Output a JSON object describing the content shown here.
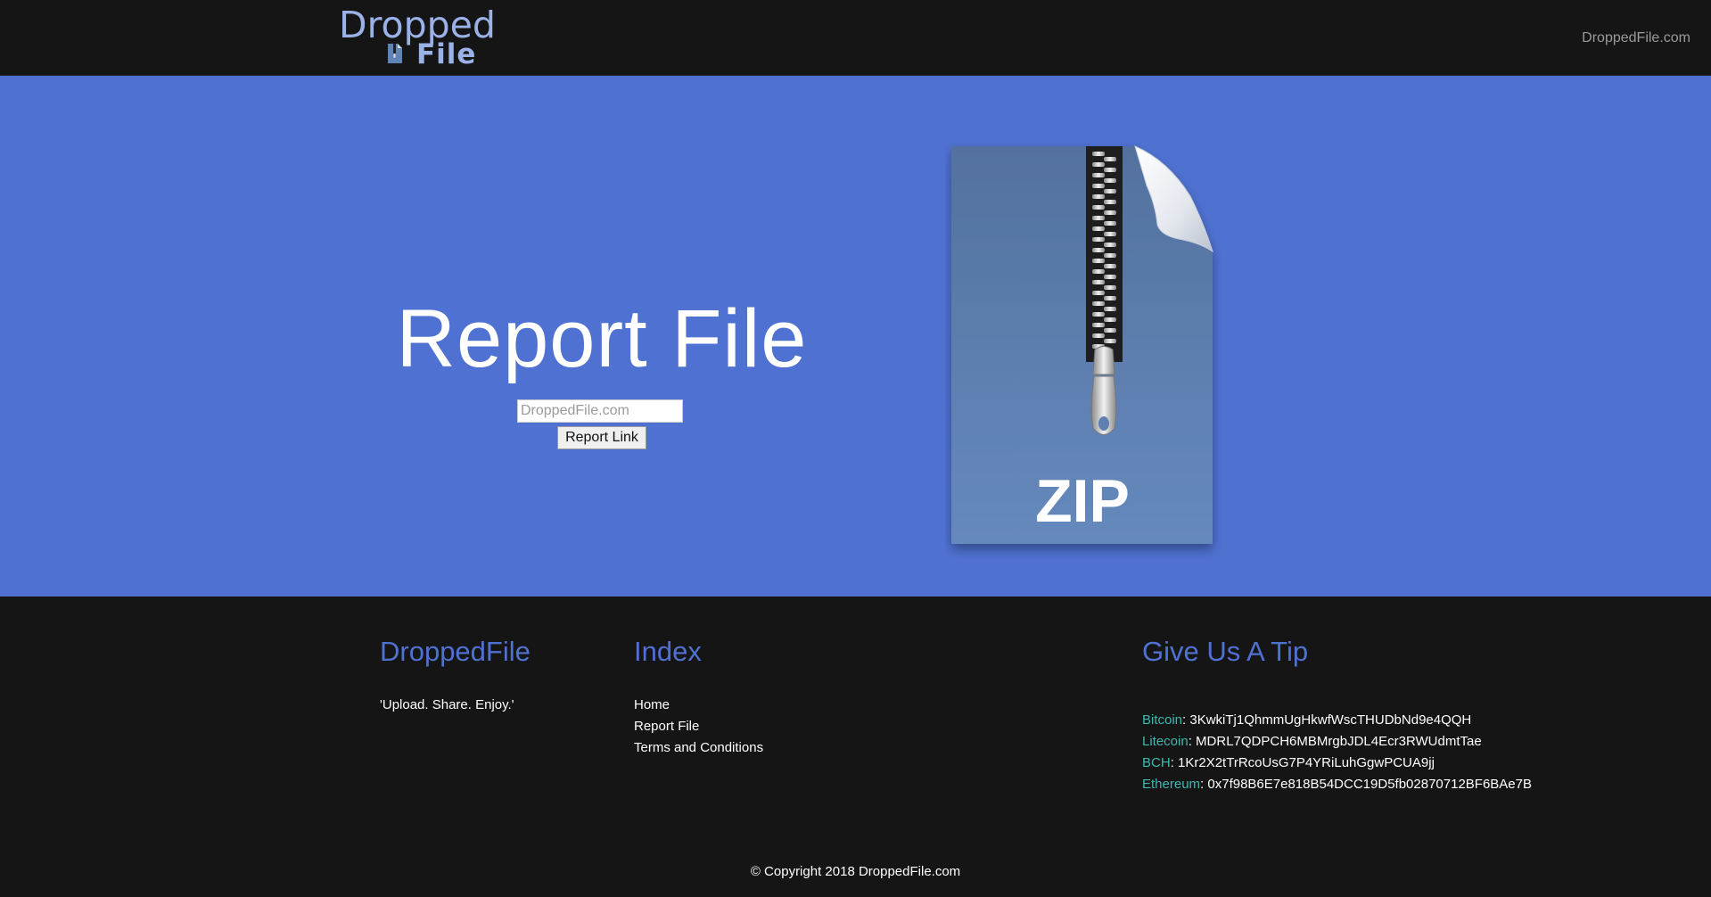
{
  "header": {
    "logo_line1": "Dropped",
    "logo_line2": "File",
    "site_link": "DroppedFile.com"
  },
  "hero": {
    "title": "Report File",
    "input_placeholder": "DroppedFile.com",
    "report_button": "Report Link",
    "zip_label": "ZIP"
  },
  "footer": {
    "about": {
      "heading": "DroppedFile",
      "tagline": "'Upload. Share. Enjoy.'"
    },
    "index": {
      "heading": "Index",
      "links": [
        "Home",
        "Report File",
        "Terms and Conditions"
      ]
    },
    "tips": {
      "heading": "Give Us A Tip",
      "items": [
        {
          "coin": "Bitcoin",
          "address": "3KwkiTj1QhmmUgHkwfWscTHUDbNd9e4QQH"
        },
        {
          "coin": "Litecoin",
          "address": "MDRL7QDPCH6MBMrgbJDL4Ecr3RWUdmtTae"
        },
        {
          "coin": "BCH",
          "address": "1Kr2X2tTrRcoUsG7P4YRiLuhGgwPCUA9jj"
        },
        {
          "coin": "Ethereum",
          "address": "0x7f98B6E7e818B54DCC19D5fb02870712BF6BAe7B"
        }
      ]
    },
    "copyright": "© Copyright 2018 DroppedFile.com"
  },
  "colors": {
    "hero_bg": "#4f71d1",
    "dark_bg": "#151515",
    "heading_blue": "#4f71d1",
    "coin_teal": "#3fb8b0",
    "logo_blue": "#9bb2e8",
    "zip_blue": "#5f85b8"
  }
}
